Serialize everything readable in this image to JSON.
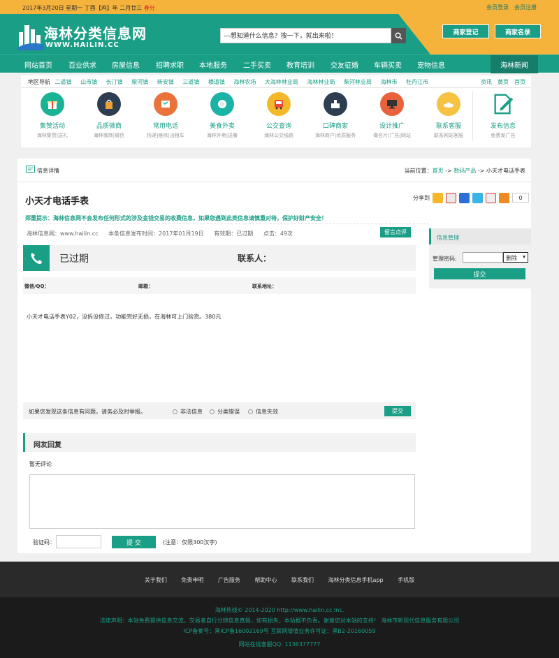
{
  "topbar": {
    "date": "2017年3月20日 星期一 丁酉【鸡】年 二月廿三",
    "solar_term": "春分",
    "login": "会员登录",
    "register": "会员注册"
  },
  "header": {
    "logo_title": "海林分类信息网",
    "logo_url": "WWW.HAILIN.CC",
    "search_placeholder": "---想知道什么信息？搜一下，就出来啦！",
    "merchant_register": "商家登记",
    "merchant_list": "商家名录"
  },
  "nav": {
    "items": [
      "网站首页",
      "百业供求",
      "房屋信息",
      "招聘求职",
      "本地服务",
      "二手买卖",
      "教育培训",
      "交友征婚",
      "车辆买卖",
      "宠物信息"
    ],
    "news": "海林新闻"
  },
  "region": {
    "label": "地区导航",
    "items": [
      "二道镇",
      "山市镇",
      "长汀镇",
      "柴河镇",
      "新安镇",
      "三道镇",
      "横道镇",
      "海林农场",
      "大海林林业局",
      "海林林业局",
      "柴河林业局",
      "海林市",
      "牡丹江市"
    ],
    "right_links": [
      "资讯",
      "黄页",
      "首页"
    ]
  },
  "categories": [
    {
      "title": "集赞活动",
      "sub": "海林集赞|送礼",
      "icon": "gift-icon",
      "color": "#1ab394"
    },
    {
      "title": "品质微商",
      "sub": "海林微商|微信",
      "icon": "shopping-bag-icon",
      "color": "#2c3e50"
    },
    {
      "title": "常用电话",
      "sub": "快递|维修|出租车",
      "icon": "phone-icon",
      "color": "#e8743b"
    },
    {
      "title": "美食外卖",
      "sub": "海林外卖|送餐",
      "icon": "dining-icon",
      "color": "#1ab3a6"
    },
    {
      "title": "公交查询",
      "sub": "海林公交线路",
      "icon": "bus-icon",
      "color": "#f5b829"
    },
    {
      "title": "口碑商家",
      "sub": "海林商户|优质服务",
      "icon": "store-icon",
      "color": "#2c3e50"
    },
    {
      "title": "设计推广",
      "sub": "做名片|广告|网站",
      "icon": "monitor-icon",
      "color": "#e8623b"
    },
    {
      "title": "联系客服",
      "sub": "联系网站客服",
      "icon": "service-icon",
      "color": "#f5c242"
    }
  ],
  "publish": {
    "title": "发布信息",
    "sub": "免费发广告"
  },
  "detail": {
    "section_title": "信息详情",
    "breadcrumb_prefix": "当前位置：",
    "breadcrumb_home": "首页",
    "breadcrumb_arrow1": "->",
    "breadcrumb_cat": "数码产品",
    "breadcrumb_arrow2": "->",
    "breadcrumb_current": "小天才电话手表",
    "title": "小天才电话手表",
    "share_label": "分享到",
    "share_count": "0",
    "warning": "郑重提示：海林信息网不会发布任何形式的涉及金钱交易的收费信息，如果您遇到此类信息请慎重对待，保护好财产安全！",
    "meta_site": "海林信息网：www.hailin.cc",
    "meta_date": "本条信息发布时间：2017年01月19日",
    "meta_valid": "有效期：已过期",
    "meta_clicks": "点击：49次",
    "message_button": "留言点评",
    "status": "已过期",
    "contact_label": "联系人：",
    "wechat_label": "微信/QQ：",
    "email_label": "邮箱：",
    "address_label": "联系地址：",
    "description": "小天才电话手表Y02，没拆没修过，功能完好无损，在海林可上门验货。380元"
  },
  "report": {
    "question": "如果您发现这条信息有问题，请务必及时举报。",
    "options": [
      "非法信息",
      "分类错误",
      "信息失效"
    ],
    "submit": "提交"
  },
  "reply": {
    "title": "网友回复",
    "no_comments": "暂无评论",
    "captcha_label": "验证码：",
    "submit": "提 交",
    "note": "(注意：仅限300汉字)"
  },
  "manage": {
    "title": "信息管理",
    "password_label": "管理密码:",
    "action": "删除",
    "submit": "提交"
  },
  "footer": {
    "links": [
      "关于我们",
      "免责申明",
      "广告服务",
      "帮助中心",
      "联系我们",
      "海林分类信息手机app",
      "手机版"
    ],
    "copyright": "海林热线© 2014-2020 http://www.hailin.cc Inc.",
    "disclaimer": "法律声明：本站免费提供信息交流，交易者自行分辨信息真假，如有损失，本站概不负责。谢谢您对本站的支持！ 海林市新现代信息服务有限公司",
    "icp": "ICP备案号：黑ICP备16002169号 互联网增值业务许可证：黑B2-20160059",
    "qq": "网站在线客服QQ: 1136377777"
  }
}
